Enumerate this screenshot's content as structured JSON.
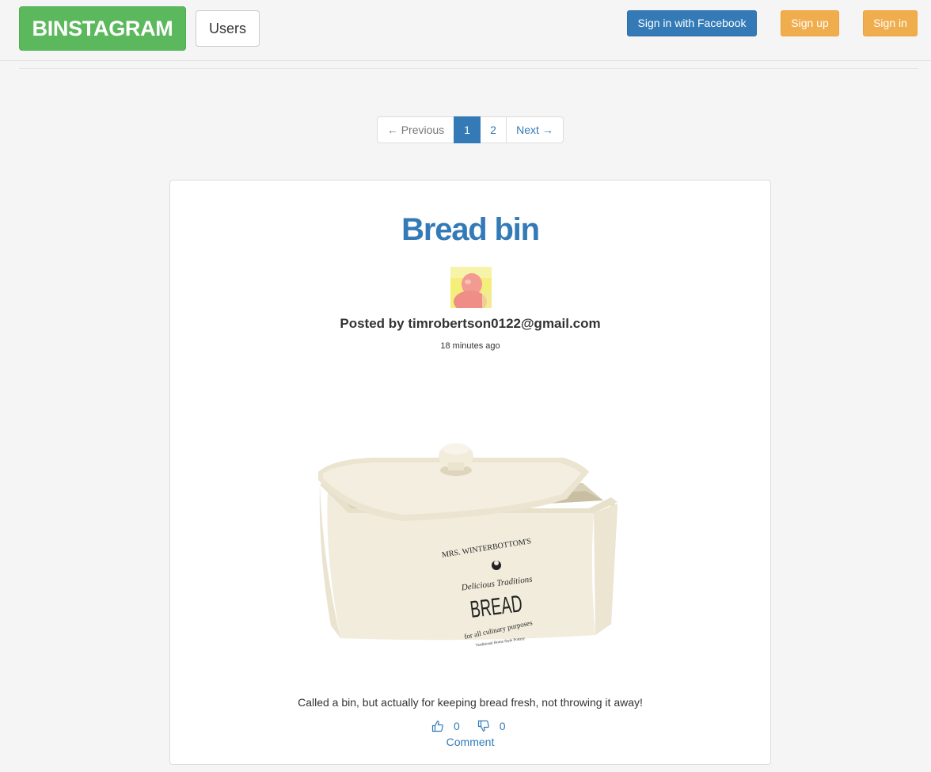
{
  "navbar": {
    "brand": "BINSTAGRAM",
    "users_label": "Users",
    "facebook_label": "Sign in with Facebook",
    "signup_label": "Sign up",
    "signin_label": "Sign in"
  },
  "pagination": {
    "previous_label": "← Previous",
    "pages": [
      "1",
      "2"
    ],
    "current_page": "1",
    "next_label": "Next →"
  },
  "post": {
    "title": "Bread bin",
    "posted_by": "Posted by timrobertson0122@gmail.com",
    "time_ago": "18 minutes ago",
    "image_text": {
      "brand_line": "MRS. WINTERBOTTOM'S",
      "script_line": "Delicious Traditions",
      "main_word": "BREAD",
      "sub_line": "for all culinary purposes",
      "bottom_line": "Traditional Home Style Pottery"
    },
    "caption": "Called a bin, but actually for keeping bread fresh, not throwing it away!",
    "likes": "0",
    "dislikes": "0",
    "comment_label": "Comment"
  },
  "colors": {
    "brand_green": "#5cb85c",
    "primary_blue": "#337ab7",
    "warning_orange": "#f0ad4e",
    "page_background": "#f5f5f5"
  },
  "icons": {
    "like": "thumbs-up-icon",
    "dislike": "thumbs-down-icon"
  }
}
